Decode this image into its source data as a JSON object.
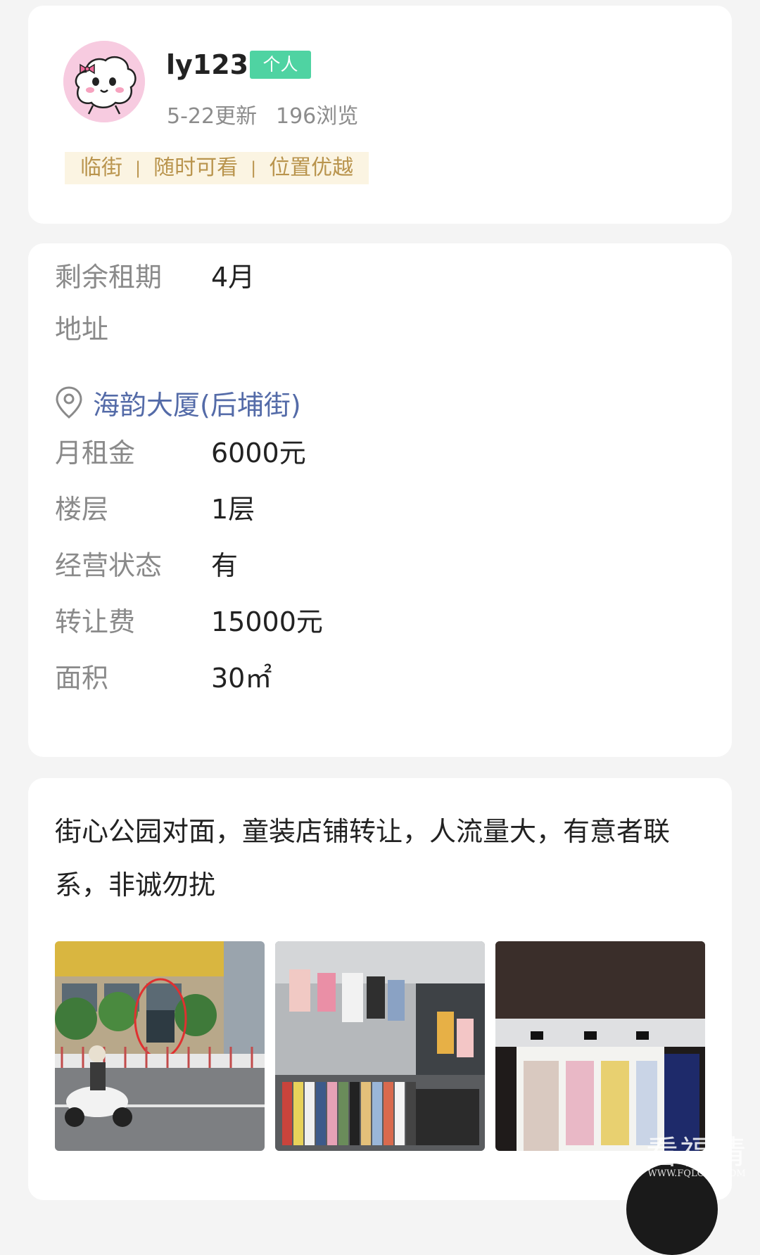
{
  "profile": {
    "username": "ly123",
    "badge": "个人",
    "updated": "5-22更新",
    "views": "196浏览",
    "tags": [
      "临街",
      "随时可看",
      "位置优越"
    ]
  },
  "details": {
    "remaining_lease": {
      "label": "剩余租期",
      "value": "4月"
    },
    "address_label": "地址",
    "address_value": "海韵大厦(后埔街)",
    "monthly_rent": {
      "label": "月租金",
      "value": "6000元"
    },
    "floor": {
      "label": "楼层",
      "value": "1层"
    },
    "operating_status": {
      "label": "经营状态",
      "value": "有"
    },
    "transfer_fee": {
      "label": "转让费",
      "value": "15000元"
    },
    "area": {
      "label": "面积",
      "value": "30㎡"
    }
  },
  "description": {
    "text": "街心公园对面，童装店铺转让，人流量大，有意者联系，非诚勿扰"
  },
  "watermark": {
    "main": "看福清",
    "sub": "WWW.FQLOOK.COM"
  },
  "colors": {
    "badge": "#4fd3a2",
    "tag_bg": "#fbf4e2",
    "tag_text": "#b9944d",
    "address_link": "#546ba8"
  },
  "icons": [
    "location-pin-icon"
  ]
}
